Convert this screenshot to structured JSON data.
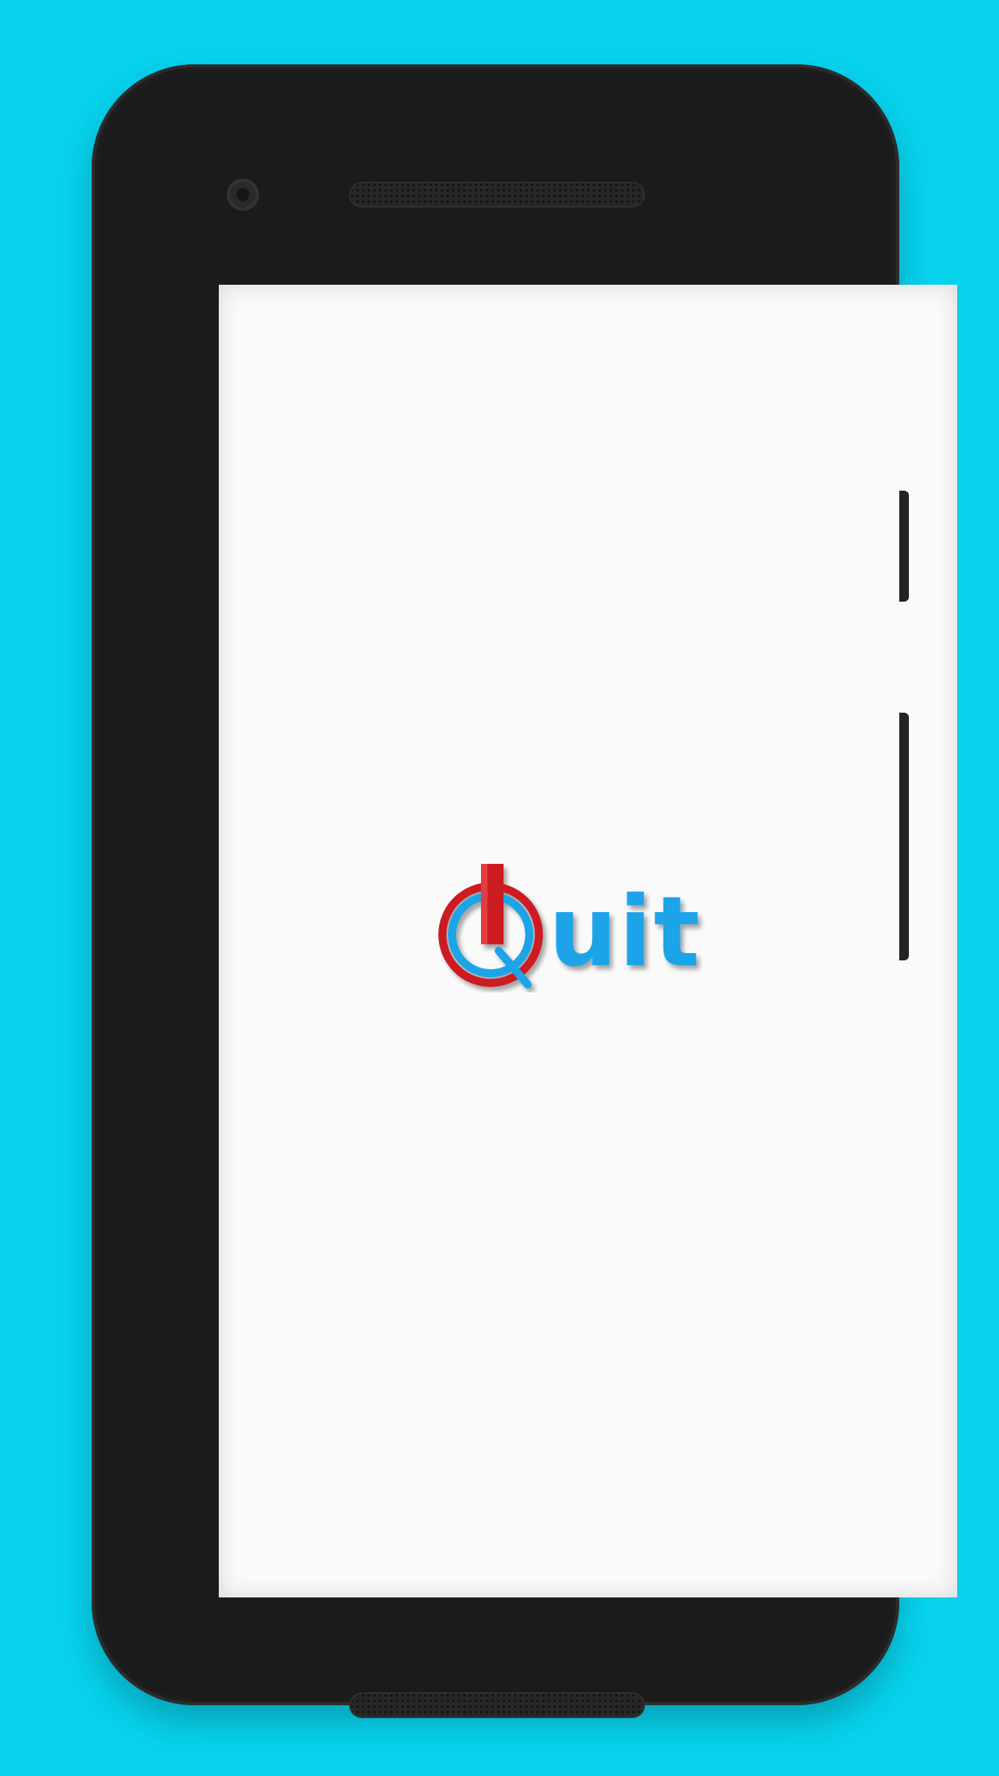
{
  "app": {
    "logo_text": "Quit",
    "logo_suffix": "uit"
  },
  "colors": {
    "background": "#07d2ec",
    "device_body": "#1b1b1b",
    "screen": "#fafafa",
    "logo_red": "#cc1e24",
    "logo_blue": "#1aa3e8"
  },
  "icons": {
    "camera": "front-camera-icon",
    "speaker_top": "earpiece-speaker",
    "speaker_bottom": "bottom-speaker",
    "logo_mark": "power-q-logo"
  }
}
